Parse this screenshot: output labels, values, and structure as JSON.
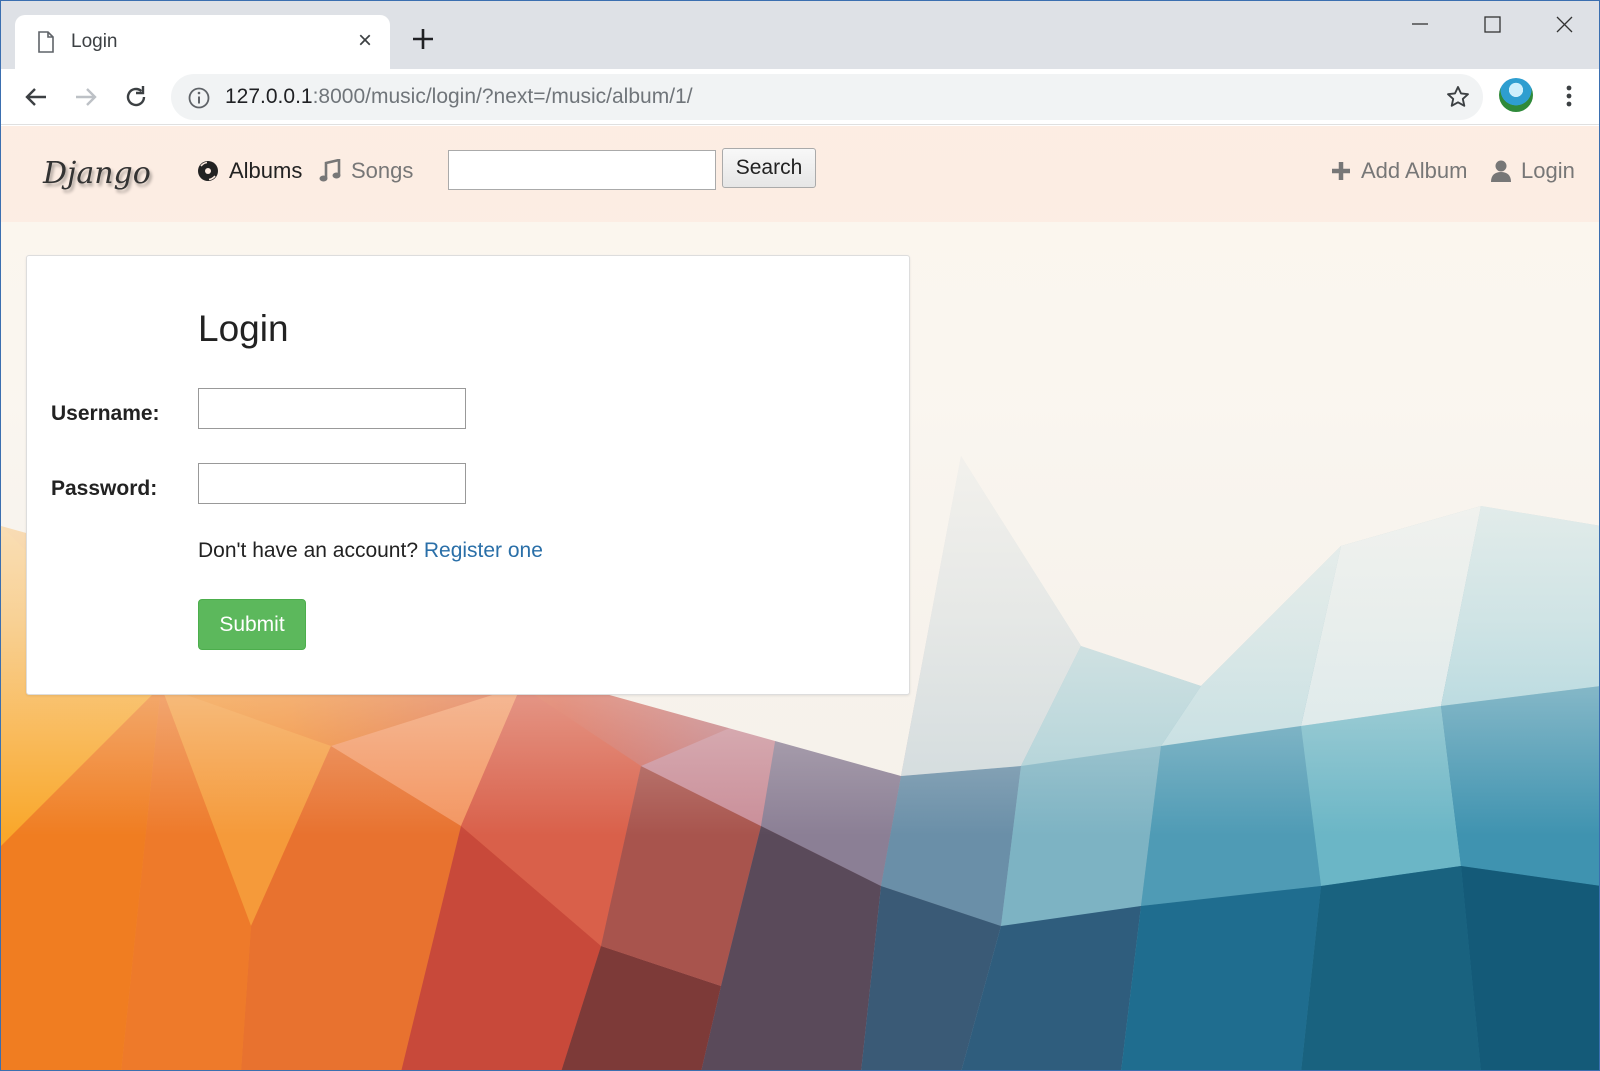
{
  "browser": {
    "tab_title": "Login",
    "url_host": "127.0.0.1",
    "url_rest": ":8000/music/login/?next=/music/album/1/"
  },
  "navbar": {
    "brand": "Django",
    "albums_label": "Albums",
    "songs_label": "Songs",
    "search_value": "",
    "search_button": "Search",
    "add_album_label": "Add Album",
    "login_label": "Login"
  },
  "login_form": {
    "title": "Login",
    "username_label": "Username:",
    "password_label": "Password:",
    "username_value": "",
    "password_value": "",
    "no_account_text": "Don't have an account? ",
    "register_link": "Register one",
    "submit_label": "Submit"
  },
  "colors": {
    "submit": "#5cb85c",
    "link": "#2a6fa8",
    "navbar_bg": "#fceae0"
  }
}
